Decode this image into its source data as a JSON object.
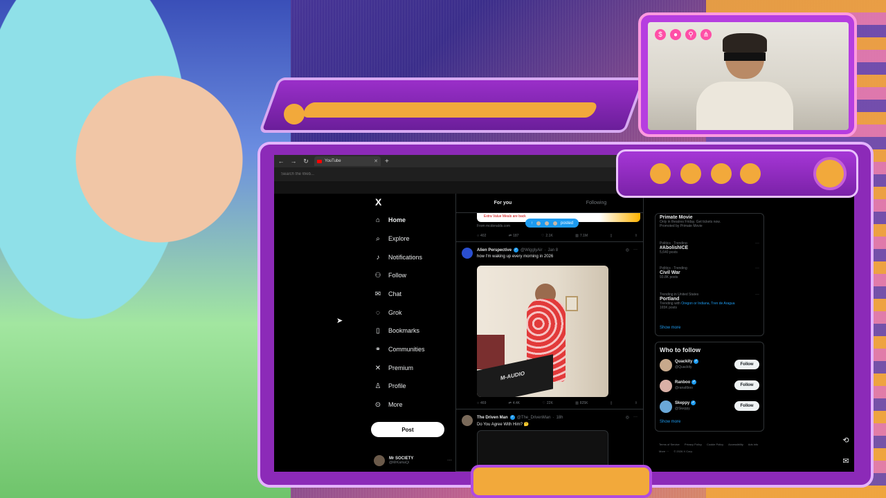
{
  "browser": {
    "tab_title": "YouTube",
    "address_placeholder": "Search the Web..."
  },
  "left_nav": {
    "logo": "X",
    "items": [
      {
        "label": "Home",
        "icon": "home-icon"
      },
      {
        "label": "Explore",
        "icon": "search-icon"
      },
      {
        "label": "Notifications",
        "icon": "bell-icon"
      },
      {
        "label": "Follow",
        "icon": "person-plus-icon"
      },
      {
        "label": "Chat",
        "icon": "mail-icon"
      },
      {
        "label": "Grok",
        "icon": "grok-icon"
      },
      {
        "label": "Bookmarks",
        "icon": "bookmark-icon"
      },
      {
        "label": "Communities",
        "icon": "communities-icon"
      },
      {
        "label": "Premium",
        "icon": "x-icon"
      },
      {
        "label": "Profile",
        "icon": "person-icon"
      },
      {
        "label": "More",
        "icon": "more-circle-icon"
      }
    ],
    "post_label": "Post",
    "account": {
      "name": "Mr SOCIETY",
      "handle": "@MrKamaQi"
    }
  },
  "timeline": {
    "tabs": [
      "For you",
      "Following"
    ],
    "prev_post": {
      "banner": "Extra Value Meals are back",
      "source": "From mcdonalds.com",
      "stats": [
        "402",
        "187",
        "2.1K",
        "7.1M"
      ]
    },
    "posted_pill": "posted",
    "posts": [
      {
        "name": "Alien Perspective",
        "handle": "@WigglyAir",
        "time": "Jan 8",
        "text": "how I'm waking up every morning in 2026",
        "media_label": "M-AUDIO",
        "stats": [
          "469",
          "4.4K",
          "22K",
          "825K"
        ]
      },
      {
        "name": "The Driven Man",
        "handle": "@The_DrivenMan",
        "time": "18h",
        "text": "Do You Agree With Him? 🤔"
      }
    ]
  },
  "trends": [
    {
      "context": "",
      "title": "Primate Movie",
      "desc": "Only in theatres Friday. Get tickets now.",
      "sub": "Promoted by Primate Movie"
    },
    {
      "context": "Politics · Trending",
      "title": "#AbolishICE",
      "sub": "5,640 posts"
    },
    {
      "context": "Politics · Trending",
      "title": "Civil War",
      "sub": "93.8K posts"
    },
    {
      "context": "Trending in United States",
      "title": "Portland",
      "desc_prefix": "Trending with ",
      "desc_link": "Oregon or Indiana, Tren de Aragua",
      "sub": "165K posts"
    }
  ],
  "show_more": "Show more",
  "who_to_follow": {
    "title": "Who to follow",
    "accounts": [
      {
        "name": "Quackity",
        "handle": "@Quackity"
      },
      {
        "name": "Ranboo",
        "handle": "@ranaltboo"
      },
      {
        "name": "Skeppy",
        "handle": "@Skeppy"
      }
    ],
    "follow_label": "Follow",
    "show_more": "Show more"
  },
  "footer": [
    "Terms of Service",
    "Privacy Policy",
    "Cookie Policy",
    "Accessibility",
    "Ads info",
    "More ···",
    "© 2026 X Corp."
  ],
  "colors": {
    "accent": "#1d9bf0",
    "overlay_purple": "#8c2ab8",
    "overlay_orange": "#f2a93b"
  }
}
